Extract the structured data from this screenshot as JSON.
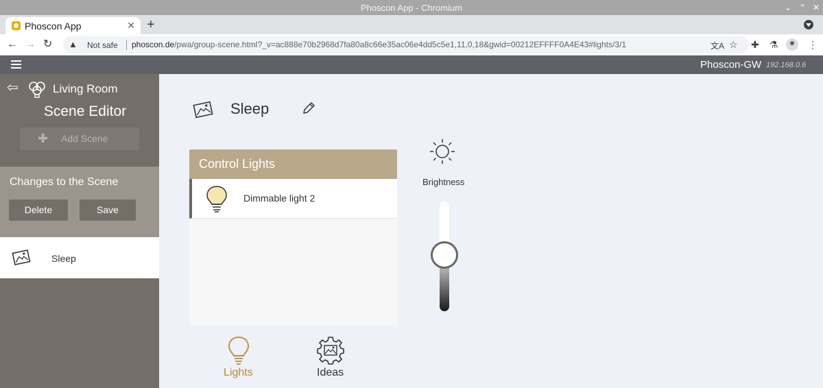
{
  "window": {
    "title": "Phoscon App - Chromium"
  },
  "browser": {
    "tab_title": "Phoscon App",
    "security_label": "Not safe",
    "url_host": "phoscon.de",
    "url_path": "/pwa/group-scene.html?_v=ac888e70b2968d7fa80a8c66e35ac06e4dd5c5e1,11,0,18&gwid=00212EFFFF0A4E43#lights/3/1"
  },
  "appbar": {
    "gateway_name": "Phoscon-GW",
    "gateway_ip": "192.168.0.6"
  },
  "sidebar": {
    "room_name": "Living Room",
    "editor_title": "Scene Editor",
    "add_scene_label": "Add Scene",
    "changes_title": "Changes to the Scene",
    "delete_label": "Delete",
    "save_label": "Save",
    "scenes": [
      {
        "label": "Sleep",
        "selected": true
      }
    ]
  },
  "main": {
    "scene_name": "Sleep",
    "panel_title": "Control Lights",
    "lights": [
      {
        "label": "Dimmable light 2"
      }
    ],
    "brightness_label": "Brightness",
    "brightness_level": 0.5,
    "bottom_tabs": [
      {
        "label": "Lights",
        "active": true
      },
      {
        "label": "Ideas",
        "active": false
      }
    ]
  },
  "colors": {
    "accent": "#b8893a",
    "panel_header": "#b9a98a",
    "sidebar": "#736e67",
    "appbar": "#5f6166"
  }
}
